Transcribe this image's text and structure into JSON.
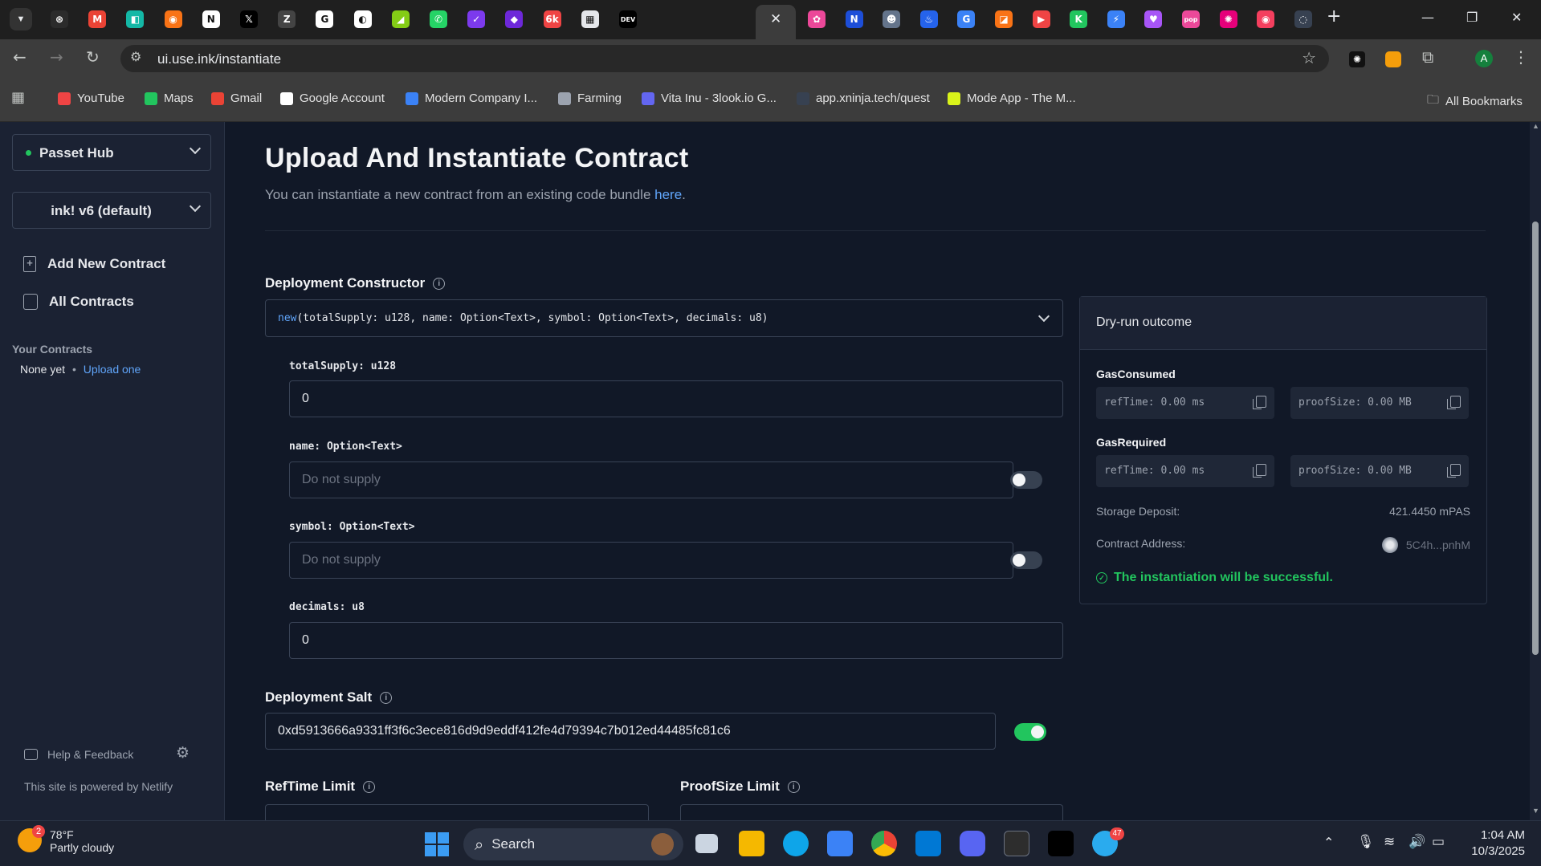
{
  "browser": {
    "url": "ui.use.ink/instantiate",
    "tab_favicons": [
      {
        "name": "openai-tab-icon",
        "color": "#2b2b2b",
        "glyph": "⊛"
      },
      {
        "name": "gmail-tab-icon",
        "color": "#ea4335",
        "glyph": "M"
      },
      {
        "name": "app-tab-icon-1",
        "color": "#14b8a6",
        "glyph": "◧"
      },
      {
        "name": "app-tab-icon-2",
        "color": "#f97316",
        "glyph": "◉"
      },
      {
        "name": "notion-tab-icon",
        "color": "#ffffff",
        "glyph": "N"
      },
      {
        "name": "x-tab-icon",
        "color": "#000000",
        "glyph": "𝕏"
      },
      {
        "name": "app-tab-icon-3",
        "color": "#444444",
        "glyph": "Z"
      },
      {
        "name": "google-tab-icon",
        "color": "#ffffff",
        "glyph": "G"
      },
      {
        "name": "app-tab-icon-4",
        "color": "#ffffff",
        "glyph": "◐"
      },
      {
        "name": "chart-tab-icon",
        "color": "#84cc16",
        "glyph": "◢"
      },
      {
        "name": "whatsapp-tab-icon",
        "color": "#25d366",
        "glyph": "✆"
      },
      {
        "name": "app-tab-icon-5",
        "color": "#7c3aed",
        "glyph": "✓"
      },
      {
        "name": "app-tab-icon-6",
        "color": "#6d28d9",
        "glyph": "◆"
      },
      {
        "name": "app-tab-icon-7",
        "color": "#ef4444",
        "glyph": "6k"
      },
      {
        "name": "app-tab-icon-8",
        "color": "#e5e7eb",
        "glyph": "▦"
      },
      {
        "name": "dev-tab-icon",
        "color": "#000000",
        "glyph": "DEV"
      }
    ],
    "tab_favicons_right": [
      {
        "name": "app-tab-icon-9",
        "color": "#ec4899",
        "glyph": "✿"
      },
      {
        "name": "app-tab-icon-10",
        "color": "#1d4ed8",
        "glyph": "N"
      },
      {
        "name": "app-tab-icon-11",
        "color": "#64748b",
        "glyph": "☻"
      },
      {
        "name": "app-tab-icon-12",
        "color": "#2563eb",
        "glyph": "♨"
      },
      {
        "name": "app-tab-icon-13",
        "color": "#3b82f6",
        "glyph": "G"
      },
      {
        "name": "app-tab-icon-14",
        "color": "#f97316",
        "glyph": "◪"
      },
      {
        "name": "youtube-tab-icon",
        "color": "#ef4444",
        "glyph": "▶"
      },
      {
        "name": "app-tab-icon-15",
        "color": "#22c55e",
        "glyph": "K"
      },
      {
        "name": "app-tab-icon-16",
        "color": "#3b82f6",
        "glyph": "⚡"
      },
      {
        "name": "app-tab-icon-17",
        "color": "#a855f7",
        "glyph": "♥"
      },
      {
        "name": "app-tab-icon-18",
        "color": "#ec4899",
        "glyph": "pop"
      },
      {
        "name": "polkadot-tab-icon",
        "color": "#e6007a",
        "glyph": "✺"
      },
      {
        "name": "app-tab-icon-19",
        "color": "#f43f5e",
        "glyph": "◉"
      },
      {
        "name": "app-tab-icon-20",
        "color": "#374151",
        "glyph": "◌"
      }
    ],
    "bookmarks": [
      {
        "label": "YouTube",
        "color": "#ef4444"
      },
      {
        "label": "Maps",
        "color": "#22c55e"
      },
      {
        "label": "Gmail",
        "color": "#ea4335"
      },
      {
        "label": "Google Account",
        "color": "#ffffff"
      },
      {
        "label": "Modern Company I...",
        "color": "#3b82f6"
      },
      {
        "label": "Farming",
        "color": "#9ca3af"
      },
      {
        "label": "Vita Inu - 3look.io G...",
        "color": "#6366f1"
      },
      {
        "label": "app.xninja.tech/quest",
        "color": "#374151"
      },
      {
        "label": "Mode App - The M...",
        "color": "#d9f31a"
      }
    ],
    "all_bookmarks": "All Bookmarks",
    "profile_initial": "A"
  },
  "sidebar": {
    "network": "Passet Hub",
    "version": "ink! v6 (default)",
    "add_contract": "Add New Contract",
    "all_contracts": "All Contracts",
    "your_contracts": "Your Contracts",
    "none_yet": "None yet",
    "upload_one": "Upload one",
    "help": "Help & Feedback",
    "powered": "This site is powered by Netlify"
  },
  "main": {
    "title": "Upload And Instantiate Contract",
    "subtitle": "You can instantiate a new contract from an existing code bundle ",
    "subtitle_link": "here",
    "deployment_constructor": "Deployment Constructor",
    "constructor_keyword": "new",
    "constructor_signature": "(totalSupply: u128, name: Option<Text>, symbol: Option<Text>, decimals: u8)",
    "args": {
      "total_supply_label": "totalSupply: u128",
      "total_supply_value": "0",
      "name_label": "name: Option<Text>",
      "name_placeholder": "Do not supply",
      "symbol_label": "symbol: Option<Text>",
      "symbol_placeholder": "Do not supply",
      "decimals_label": "decimals: u8",
      "decimals_value": "0"
    },
    "deployment_salt": "Deployment Salt",
    "salt_value": "0xd5913666a9331ff3f6c3ece816d9d9eddf412fe4d79394c7b012ed44485fc81c6",
    "reftime_limit": "RefTime Limit",
    "proofsize_limit": "ProofSize Limit"
  },
  "outcome": {
    "title": "Dry-run outcome",
    "gas_consumed": "GasConsumed",
    "gas_required": "GasRequired",
    "consumed_reftime": "refTime: 0.00 ms",
    "consumed_proofsize": "proofSize: 0.00 MB",
    "required_reftime": "refTime: 0.00 ms",
    "required_proofsize": "proofSize: 0.00 MB",
    "storage_deposit_label": "Storage Deposit:",
    "storage_deposit_value": "421.4450 mPAS",
    "contract_address_label": "Contract Address:",
    "contract_address_value": "5C4h...pnhM",
    "success": "The instantiation will be successful."
  },
  "taskbar": {
    "weather_temp": "78°F",
    "weather_desc": "Partly cloudy",
    "weather_badge": "2",
    "search": "Search",
    "time": "1:04 AM",
    "date": "10/3/2025",
    "telegram_badge": "47"
  },
  "colors": {
    "accent_green": "#22c55e",
    "link_blue": "#60a5fa",
    "page_bg": "#111827"
  }
}
